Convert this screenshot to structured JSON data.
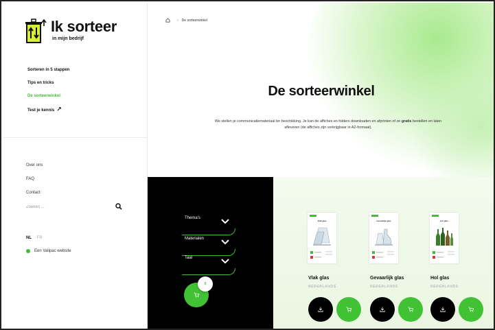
{
  "brand": {
    "title": "Ik sorteer",
    "subtitle": "in mijn bedrijf"
  },
  "nav": {
    "primary": [
      {
        "label": "Sorteren in 5 stappen"
      },
      {
        "label": "Tips en tricks"
      },
      {
        "label": "De sorteerwinkel",
        "active": true
      },
      {
        "label": "Test je kennis",
        "icon": "arrow-up-right-icon"
      }
    ],
    "secondary": [
      {
        "label": "Over ons"
      },
      {
        "label": "FAQ"
      },
      {
        "label": "Contact"
      }
    ],
    "search_placeholder": "Zoeken ...",
    "languages": {
      "nl": "NL",
      "fr": "FR"
    },
    "valipac": "Een Valipac website"
  },
  "breadcrumb": {
    "current": "De sorteerwinkel"
  },
  "hero": {
    "title": "De sorteerwinkel",
    "text_before": "We stellen je communicatiemateriaal ter beschikking. Je kan de affiches en folders downloaden en afprinten of ze ",
    "text_bold": "gratis",
    "text_after": " bestellen en laten afleveren (de affiches zijn verkrijgbaar in A2-formaat)."
  },
  "filters": [
    {
      "label": "Thema's"
    },
    {
      "label": "Materialen"
    },
    {
      "label": "Taal"
    }
  ],
  "cart": {
    "count": "0"
  },
  "products": [
    {
      "name": "Vlak glas",
      "language": "NEDERLANDS",
      "poster_title": "Vlak glas"
    },
    {
      "name": "Gevaarlijk glas",
      "language": "NEDERLANDS",
      "poster_title": "Gevaarlijk glas"
    },
    {
      "name": "Hol glas",
      "language": "NEDERLANDS",
      "poster_title": "Hol glas"
    }
  ],
  "colors": {
    "accent": "#46b83a",
    "cart_green": "#41c235",
    "dark_panel": "#000000",
    "products_bg": "#eef8e7"
  }
}
